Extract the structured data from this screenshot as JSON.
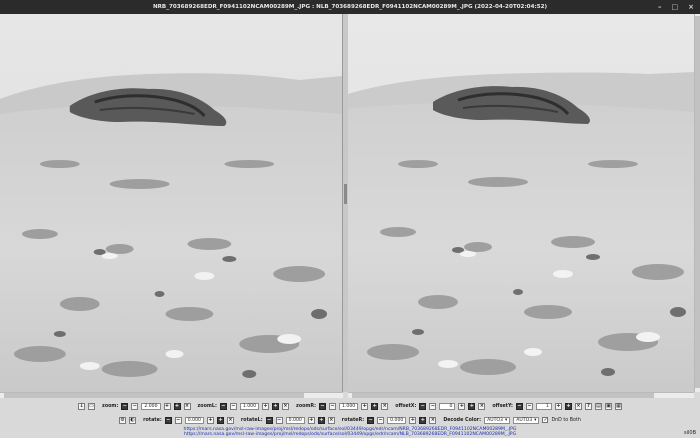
{
  "window": {
    "title": "NRB_703689268EDR_F0941102NCAM00289M_.JPG : NLB_703689268EDR_F0941102NCAM00289M_.JPG (2022-04-20T02:04:52)",
    "controls": [
      "–",
      "□",
      "×"
    ]
  },
  "toolbar_top": {
    "zoom_label": "zoom:",
    "zoom_value": "2.000",
    "zoomL_label": "zoomL:",
    "zoomL_value": "1.000",
    "zoomR_label": "zoomR:",
    "zoomR_value": "1.000",
    "offsetX_label": "offsetX:",
    "offsetX_value": "0",
    "offsetY_label": "offsetY:",
    "offsetY_value": "1"
  },
  "toolbar_bottom": {
    "rotate_label": "rotate:",
    "rotate_value": "0.000",
    "rotateL_label": "rotateL:",
    "rotateL_value": "0.000",
    "rotateR_label": "rotateR:",
    "rotateR_value": "0.000",
    "decode_label": "Decode Color:",
    "decode_left": "AUTO3",
    "decode_right": "AUTO3",
    "dnd_label": "DnD to Both"
  },
  "urls": [
    "https://mars.nasa.gov/msl-raw-images/proj/msl/redops/ods/surface/sol/03449/opgs/edr/ncam/NRB_703689268EDR_F0941102NCAM00289M_.JPG",
    "https://mars.nasa.gov/msl-raw-images/proj/msl/redops/ods/surface/sol/03449/opgs/edr/ncam/NLB_703689268EDR_F0941102NCAM00289M_.JPG"
  ],
  "corner_text": "sil0B",
  "icons": {
    "window_min": "minimize-icon",
    "window_max": "maximize-icon",
    "window_close": "close-icon"
  }
}
